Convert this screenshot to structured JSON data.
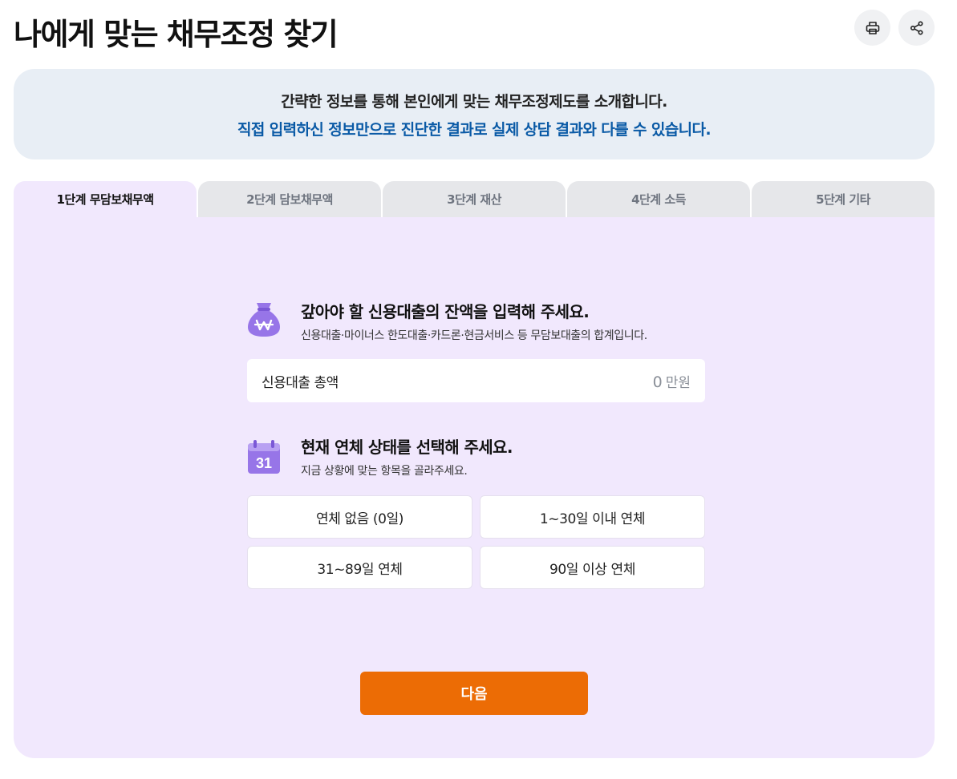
{
  "page": {
    "title": "나에게 맞는 채무조정 찾기"
  },
  "header": {
    "print_icon": "print-icon",
    "share_icon": "share-icon"
  },
  "notice": {
    "line1": "간략한 정보를 통해 본인에게 맞는 채무조정제도를 소개합니다.",
    "line2": "직접 입력하신 정보만으로 진단한 결과로 실제 상담 결과와 다를 수 있습니다."
  },
  "tabs": [
    {
      "label": "1단계 무담보채무액",
      "active": true
    },
    {
      "label": "2단계 담보채무액"
    },
    {
      "label": "3단계 재산"
    },
    {
      "label": "4단계 소득"
    },
    {
      "label": "5단계 기타"
    }
  ],
  "question1": {
    "icon": "money-bag-icon",
    "title": "갚아야 할 신용대출의 잔액을 입력해 주세요.",
    "desc": "신용대출·마이너스 한도대출·카드론·현금서비스 등 무담보대출의 합계입니다.",
    "field_label": "신용대출 총액",
    "field_value": "0",
    "field_unit": "만원"
  },
  "question2": {
    "icon": "calendar-icon",
    "calendar_day": "31",
    "title": "현재 연체 상태를 선택해 주세요.",
    "desc": "지금 상황에 맞는 항목을 골라주세요.",
    "options": [
      "연체 없음 (0일)",
      "1~30일 이내 연체",
      "31~89일 연체",
      "90일 이상 연체"
    ]
  },
  "next_button": "다음",
  "colors": {
    "accent": "#ec6c05",
    "panel": "#f1e8fd",
    "notice_blue": "#0a5aa6",
    "icon_purple": "#9775e8"
  }
}
